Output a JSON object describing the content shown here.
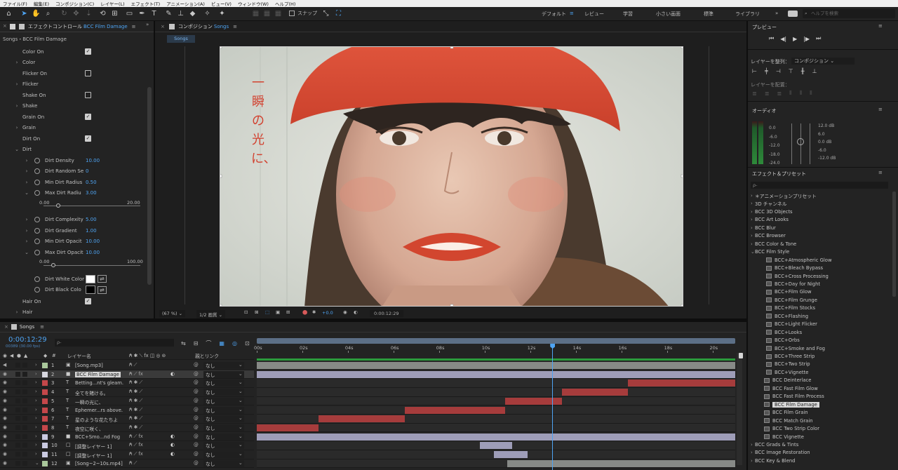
{
  "menu": [
    "ファイル(F)",
    "編集(E)",
    "コンポジション(C)",
    "レイヤー(L)",
    "エフェクト(T)",
    "アニメーション(A)",
    "ビュー(V)",
    "ウィンドウ(W)",
    "ヘルプ(H)"
  ],
  "toolbar": {
    "snap_label": "スナップ",
    "workspaces": [
      "デフォルト",
      "レビュー",
      "学習",
      "小さい画面",
      "標準",
      "ライブラリ"
    ],
    "help_search_placeholder": "ヘルプを検索"
  },
  "effect_controls": {
    "panel_title": "エフェクトコントロール",
    "panel_target": "BCC Film Damage",
    "breadcrumb": "Songs・BCC Film Damage",
    "rows": [
      {
        "label": "Color On",
        "checkbox": true
      },
      {
        "label": "Color",
        "group": true
      },
      {
        "label": "Flicker On",
        "checkbox": false
      },
      {
        "label": "Flicker",
        "group": true
      },
      {
        "label": "Shake On",
        "checkbox": false
      },
      {
        "label": "Shake",
        "group": true
      },
      {
        "label": "Grain On",
        "checkbox": true
      },
      {
        "label": "Grain",
        "group": true
      },
      {
        "label": "Dirt On",
        "checkbox": true
      },
      {
        "label": "Dirt",
        "group": true,
        "open": true
      }
    ],
    "dirt_params": [
      {
        "label": "Dirt Density",
        "value": "10.00"
      },
      {
        "label": "Dirt Random Se",
        "value": "0"
      },
      {
        "label": "Min Dirt Radius",
        "value": "0.50"
      },
      {
        "label": "Max Dirt Radiu",
        "value": "3.00",
        "slider": {
          "min": "0.00",
          "max": "20.00",
          "pos": 0.15
        }
      },
      {
        "label": "Dirt Complexity",
        "value": "5.00"
      },
      {
        "label": "Dirt Gradient",
        "value": "1.00"
      },
      {
        "label": "Min Dirt Opacit",
        "value": "10.00"
      },
      {
        "label": "Max Dirt Opacit",
        "value": "10.00",
        "slider": {
          "min": "0.00",
          "max": "100.00",
          "pos": 0.1
        }
      }
    ],
    "dirt_white_color": {
      "label": "Dirt White Color",
      "swatch": "#ffffff"
    },
    "dirt_black_color": {
      "label": "Dirt Black Colo",
      "swatch": "#000000"
    },
    "hair_on": {
      "label": "Hair On",
      "checkbox": true
    },
    "hair": {
      "label": "Hair"
    }
  },
  "composition": {
    "panel_title": "コンポジション",
    "panel_target": "Songs",
    "tab": "Songs",
    "overlay_text": "一瞬の光に、",
    "zoom": "(67 %)",
    "resolution": "1/2 画質",
    "exposure": "+0.0",
    "timecode": "0:00:12:29"
  },
  "preview": {
    "title": "プレビュー"
  },
  "align": {
    "label_align": "レイヤーを整列：",
    "target": "コンポジション",
    "label_distribute": "レイヤーを配置："
  },
  "audio": {
    "title": "オーディオ",
    "left_scale": [
      "0.0",
      "-6.0",
      "-12.0",
      "-18.0",
      "-24.0"
    ],
    "right_scale": [
      "12.0 dB",
      "6.0",
      "0.0 dB",
      "-6.0",
      "-12.0 dB"
    ]
  },
  "effects_presets": {
    "title": "エフェクト＆プリセット",
    "search_placeholder": "ρ-",
    "top": [
      "＊アニメーションプリセット",
      "3D チャンネル",
      "BCC 3D Objects",
      "BCC Art Looks",
      "BCC Blur",
      "BCC Browser",
      "BCC Color & Tone"
    ],
    "open_folder": "BCC Film Style",
    "film_style_items": [
      "BCC+Atmospheric Glow",
      "BCC+Bleach Bypass",
      "BCC+Cross Processing",
      "BCC+Day for Night",
      "BCC+Film Glow",
      "BCC+Film Grunge",
      "BCC+Film Stocks",
      "BCC+Flashing",
      "BCC+Light Flicker",
      "BCC+Looks",
      "BCC+Orbs",
      "BCC+Smoke and Fog",
      "BCC+Three Strip",
      "BCC+Two Strip",
      "BCC+Vignette",
      "BCC Deinterlace",
      "BCC Fast Film Glow",
      "BCC Fast Film Process",
      "BCC Film Damage",
      "BCC Film Grain",
      "BCC Match Grain",
      "BCC Two Strip Color",
      "BCC Vignette"
    ],
    "selected": "BCC Film Damage",
    "bottom": [
      "BCC Grads & Tints",
      "BCC Image Restoration",
      "BCC Key & Blend"
    ]
  },
  "timeline": {
    "tab": "Songs",
    "timecode": "0:00:12:29",
    "sub_timecode": "00389 (30.00 fps)",
    "search_placeholder": "ρ-",
    "col_number": "#",
    "col_layer": "レイヤー名",
    "col_parent": "親とリンク",
    "ruler": [
      "00s",
      "02s",
      "04s",
      "06s",
      "08s",
      "10s",
      "12s",
      "14s",
      "16s",
      "18s",
      "20s"
    ],
    "ruler_end_seconds": 21,
    "playhead_seconds": 12.97,
    "parent_value": "なし",
    "layers": [
      {
        "num": "1",
        "type": "av",
        "name": "[Song.mp3]",
        "label": "#a9c79b",
        "bar_color": "#878a87",
        "start": 0,
        "end": 21
      },
      {
        "num": "2",
        "type": "solid",
        "name": "BCC Film Damage",
        "label": "#d8d8e0",
        "selected": true,
        "fx": true,
        "bar_color": "#9e9db8",
        "start": 0,
        "end": 21
      },
      {
        "num": "3",
        "type": "text",
        "name": "Betting...nt's gleam.",
        "label": "#c4474a",
        "bar_color": "#a63c3c",
        "start": 16.3,
        "end": 21
      },
      {
        "num": "4",
        "type": "text",
        "name": "全てを賭ける。",
        "label": "#c4474a",
        "bar_color": "#a63c3c",
        "start": 13.4,
        "end": 16.3
      },
      {
        "num": "5",
        "type": "text",
        "name": "一瞬の光に、",
        "label": "#c4474a",
        "bar_color": "#a63c3c",
        "start": 10.9,
        "end": 13.4
      },
      {
        "num": "6",
        "type": "text",
        "name": "Ephemer...rs above.",
        "label": "#c4474a",
        "bar_color": "#a63c3c",
        "start": 6.5,
        "end": 10.9
      },
      {
        "num": "7",
        "type": "text",
        "name": "星のような花たちよ",
        "label": "#c4474a",
        "bar_color": "#a63c3c",
        "start": 2.7,
        "end": 6.5
      },
      {
        "num": "8",
        "type": "text",
        "name": "夜空に咲く、",
        "label": "#c4474a",
        "bar_color": "#a63c3c",
        "start": 0,
        "end": 2.7
      },
      {
        "num": "9",
        "type": "solid",
        "name": "BCC+Smo...nd Fog",
        "label": "#c9c9e0",
        "fx": true,
        "bar_color": "#9e9db8",
        "start": 0,
        "end": 21
      },
      {
        "num": "10",
        "type": "adj",
        "name": "[調整レイヤー 1]",
        "label": "#c9c9e0",
        "fx": true,
        "bar_color": "#9e9db8",
        "start": 9.8,
        "end": 11.2
      },
      {
        "num": "11",
        "type": "adj",
        "name": "[調整レイヤー 1]",
        "label": "#c9c9e0",
        "fx": true,
        "bar_color": "#9e9db8",
        "start": 10.4,
        "end": 11.9
      },
      {
        "num": "12",
        "type": "av",
        "name": "[Song~2~10s.mp4]",
        "label": "#a9c79b",
        "bar_color": "#878a87",
        "start": 11,
        "end": 21
      }
    ]
  },
  "colors": {
    "accent": "#2d8ceb",
    "timecode": "#4ea4f3"
  }
}
